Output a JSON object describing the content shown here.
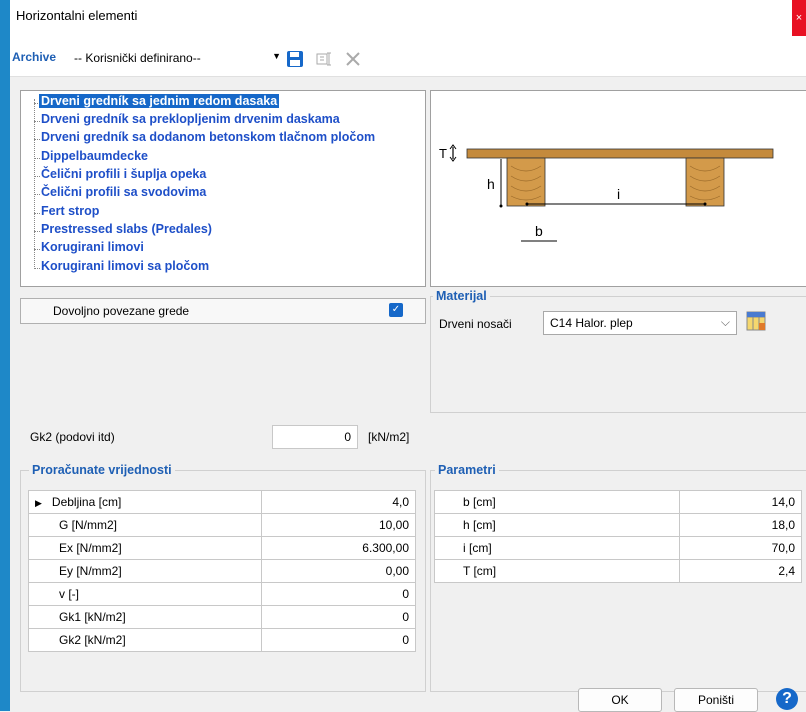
{
  "window": {
    "title": "Horizontalni elementi",
    "close_glyph": "×"
  },
  "toolbar": {
    "archive_label": "Archive",
    "archive_value": "-- Korisnički definirano--",
    "icons": [
      "dropdown-arrow-icon",
      "save-icon",
      "rename-icon",
      "delete-icon"
    ]
  },
  "tree": {
    "items": [
      "Drveni gredník sa jednim redom dasaka",
      "Drveni gredník sa preklopljenim drvenim daskama",
      "Drveni gredník sa dodanom betonskom tlačnom pločom",
      "Dippelbaumdecke",
      "Čelični profili i šuplja opeka",
      "Čelični profili sa svodovima",
      "Fert strop",
      "Prestressed slabs (Predales)",
      "Korugirani limovi",
      "Korugirani limovi sa pločom"
    ],
    "selected_index": 0
  },
  "diagram": {
    "labels": {
      "T": "T",
      "h": "h",
      "i": "i",
      "b": "b"
    }
  },
  "beams_checkbox": {
    "label": "Dovoljno povezane grede",
    "checked": true
  },
  "material": {
    "title": "Materijal",
    "label": "Drveni nosači",
    "value": "C14 Halor. plep"
  },
  "gk2": {
    "label": "Gk2 (podovi itd)",
    "value": "0",
    "unit": "[kN/m2]"
  },
  "computed": {
    "title": "Proračunate vrijednosti",
    "rows": [
      {
        "name": "Debljina [cm]",
        "value": "4,0"
      },
      {
        "name": "G [N/mm2]",
        "value": "10,00"
      },
      {
        "name": "Ex [N/mm2]",
        "value": "6.300,00"
      },
      {
        "name": "Ey [N/mm2]",
        "value": "0,00"
      },
      {
        "name": "v [-]",
        "value": "0"
      },
      {
        "name": "Gk1 [kN/m2]",
        "value": "0"
      },
      {
        "name": "Gk2 [kN/m2]",
        "value": "0"
      }
    ]
  },
  "params": {
    "title": "Parametri",
    "rows": [
      {
        "name": "b [cm]",
        "value": "14,0"
      },
      {
        "name": "h [cm]",
        "value": "18,0"
      },
      {
        "name": "i [cm]",
        "value": "70,0"
      },
      {
        "name": "T [cm]",
        "value": "2,4"
      }
    ]
  },
  "buttons": {
    "ok": "OK",
    "cancel": "Poništi",
    "help": "?"
  },
  "colors": {
    "accent": "#1668c9",
    "wood": "#c48a3c",
    "group_title": "#1e5fb4"
  }
}
